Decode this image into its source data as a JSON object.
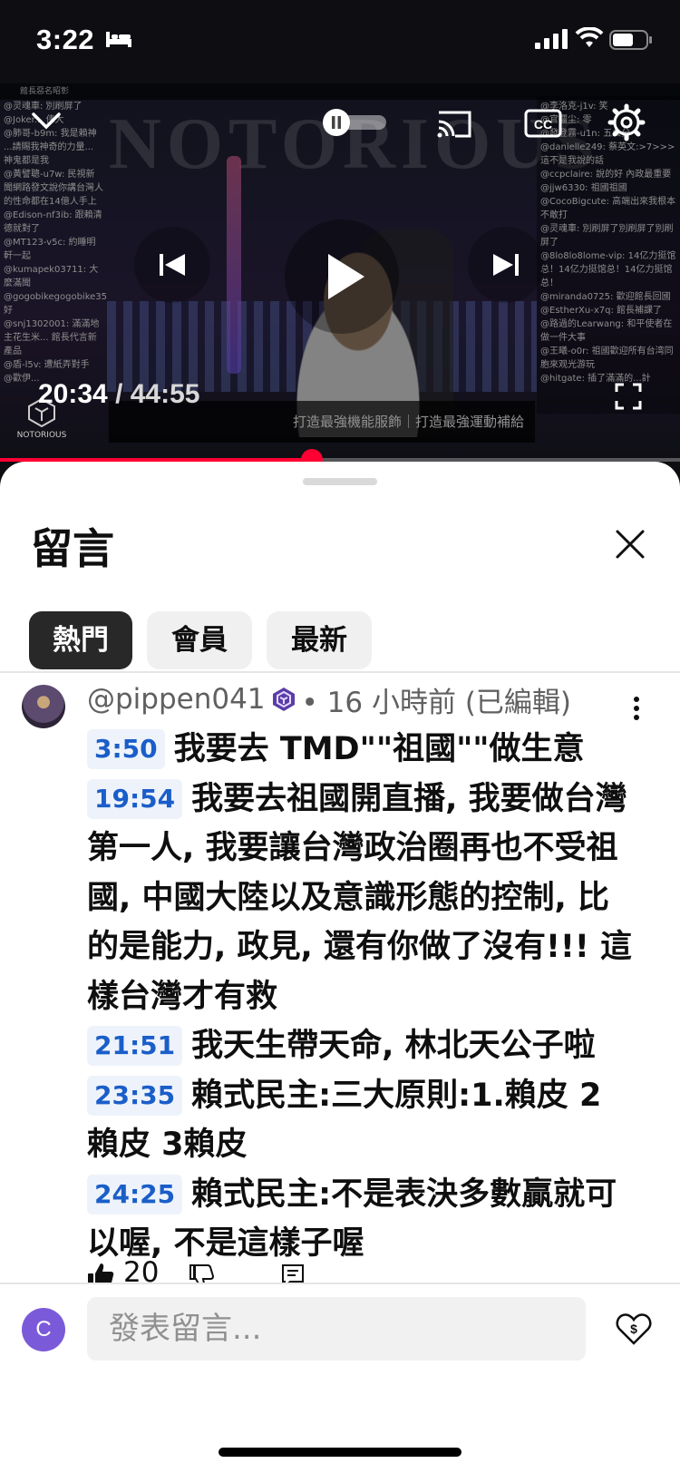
{
  "status": {
    "time": "3:22"
  },
  "video": {
    "timecode_current": "20:34",
    "timecode_separator": " / ",
    "timecode_total": "44:55",
    "progress": 0.458,
    "logo_text": "NOTORIOUS",
    "ad_text": "打造最強機能服飾｜打造最強運動補給",
    "banner_text": "NOTORIOUS",
    "topbar_text": "館長惡名昭彰",
    "chat_left": [
      "@灵魂車: 別刷屏了",
      "@Joker... 伟大",
      "@肺哥-b9m: 我是賴神",
      "...請賜我神奇的力量...",
      "神鬼都是我",
      "@黃譬聰-u7w: 民視新聞網路發文說你講台灣人的性命都在14億人手上",
      "@Edison-nf3ib: 跟賴清德就對了",
      "@MT123-v5c: 約睡明軒一起",
      "@kumapek03711: 大麼滿聞",
      "@gogobikegogobike35 好",
      "@snj1302001: 滿滿地主花生米... 館長代言新產品",
      "@盾-l5v: 遭紙弄對手",
      "@歡伊..."
    ],
    "chat_right": [
      "@李洛克-j1v: 笑",
      "@官僵尘: 零",
      "@發登霧-u1n: 五公分",
      "@danielle249: 蔡英文:>7>>> 這不是我說的話",
      "@ccpclaire: 說的好 內政最重要",
      "@jjw6330: 祖國祖國",
      "@CocoBigcute: 高端出來我根本不敢打",
      "@灵魂車: 別刷屏了別刷屏了別刷屏了",
      "@8lo8lo8lome-vip: 14亿力挺馆总！14亿力挺馆总！14亿力挺馆总！",
      "@miranda0725: 歡迎館長回國",
      "@EstherXu-x7q: 館長補課了",
      "@路過的Learwang: 和平使者在做一件大事",
      "@王曦-o0r: 祖國歡迎所有台湾同胞來观光游玩",
      "@hitgate: 插了滿滿的...計"
    ]
  },
  "sheet": {
    "title": "留言",
    "chips": [
      "熱門",
      "會員",
      "最新"
    ]
  },
  "comment": {
    "handle": "@pippen041",
    "meta": " • 16 小時前 (已編輯)",
    "lines": [
      {
        "ts": "3:50",
        "text": "我要去 TMD\"\"祖國\"\"做生意"
      },
      {
        "ts": "19:54",
        "text": "我要去祖國開直播, 我要做台灣第一人, 我要讓台灣政治圈再也不受祖國, 中國大陸以及意識形態的控制, 比的是能力, 政見, 還有你做了沒有!!! 這樣台灣才有救"
      },
      {
        "ts": "21:51",
        "text": "我天生帶天命, 林北天公子啦"
      },
      {
        "ts": "23:35",
        "text": "賴式民主:三大原則:1.賴皮 2 賴皮 3賴皮"
      },
      {
        "ts": "24:25",
        "text": "賴式民主:不是表決多數贏就可以喔, 不是這樣子喔"
      }
    ],
    "likes": "20"
  },
  "composer": {
    "avatar_letter": "C",
    "placeholder": "發表留言..."
  },
  "colors": {
    "accent_red": "#ff0033",
    "timestamp_blue": "#1a5ec9",
    "chip_active": "#282828",
    "avatar_purple": "#7b5ad9"
  },
  "icons": [
    "bed-icon",
    "signal-icon",
    "wifi-icon",
    "battery-icon",
    "chevron-down-icon",
    "pause-icon",
    "cast-icon",
    "cc-icon",
    "gear-icon",
    "previous-icon",
    "play-icon",
    "next-icon",
    "fullscreen-icon",
    "close-icon",
    "member-badge-icon",
    "more-vert-icon",
    "thumbs-up-icon",
    "thumbs-down-icon",
    "reply-icon",
    "super-thanks-icon"
  ]
}
